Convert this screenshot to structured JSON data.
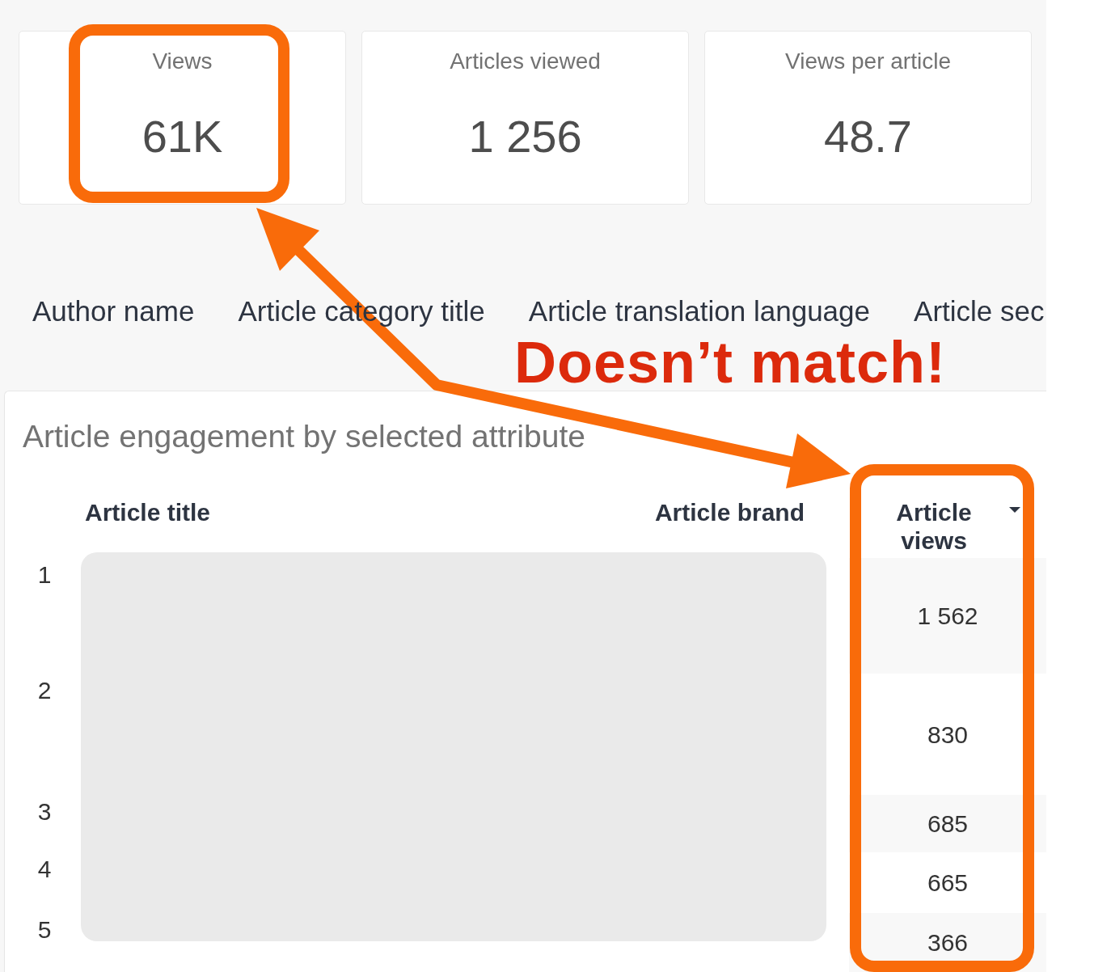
{
  "stats": [
    {
      "label": "Views",
      "value": "61K"
    },
    {
      "label": "Articles viewed",
      "value": "1 256"
    },
    {
      "label": "Views per article",
      "value": "48.7"
    }
  ],
  "tabs": [
    {
      "label": "Author name"
    },
    {
      "label": "Article category title"
    },
    {
      "label": "Article translation language"
    },
    {
      "label": "Article sec"
    }
  ],
  "panel": {
    "title": "Article engagement by selected attribute",
    "table": {
      "columns": [
        {
          "label": "Article title",
          "sorted": false
        },
        {
          "label": "Article brand",
          "sorted": false
        },
        {
          "label": "Article views",
          "sorted": true
        }
      ],
      "rows": [
        {
          "number": "1",
          "views": "1 562"
        },
        {
          "number": "2",
          "views": "830"
        },
        {
          "number": "3",
          "views": "685"
        },
        {
          "number": "4",
          "views": "665"
        },
        {
          "number": "5",
          "views": "366"
        }
      ]
    }
  },
  "annotation": {
    "text": "Doesn’t match!"
  }
}
